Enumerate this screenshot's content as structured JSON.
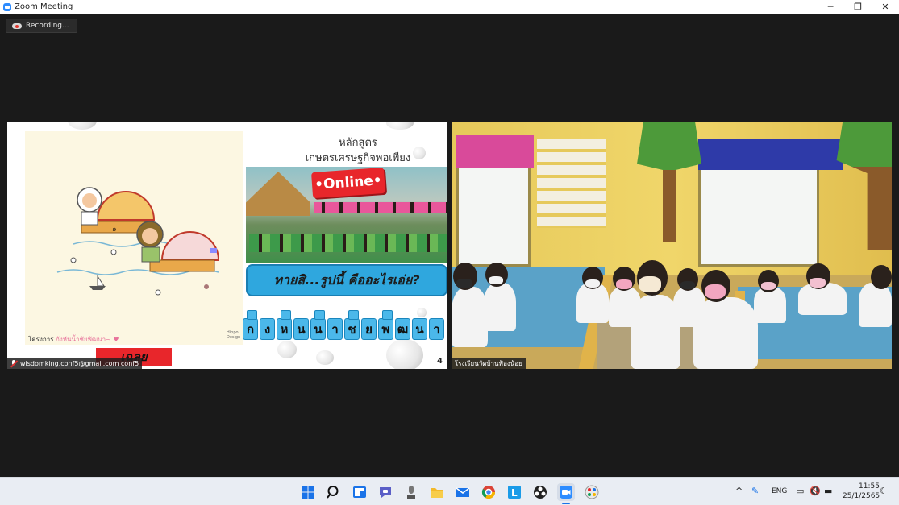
{
  "window": {
    "title": "Zoom Meeting",
    "controls": [
      "─",
      "❐",
      "✕"
    ]
  },
  "recording": {
    "label": "Recording..."
  },
  "tiles": {
    "left": {
      "name": "wisdomking.conf5@gmail.com conf5",
      "slide": {
        "course_line1": "หลักสูตร",
        "course_line2": "เกษตรเศรษฐกิจพอเพียง",
        "online": "•Online•",
        "question": "ทายสิ...รูปนี้ คืออะไรเอ่ย?",
        "letters": [
          "ก",
          "ง",
          "ห",
          "น",
          "น",
          "า",
          "ช",
          "ย",
          "พ",
          "ฒ",
          "น",
          "า"
        ],
        "answer_button": "เฉลย",
        "project_prefix": "โครงการ",
        "project_name": "กังหันน้ำชัยพัฒนา~",
        "publisher": "Hippo Design",
        "page_number": "4"
      }
    },
    "right": {
      "name": "โรงเรียนวัดบ้านฟ้องน้อย"
    }
  },
  "taskbar": {
    "apps": [
      "windows-start",
      "search",
      "widgets",
      "teams-chat",
      "microphone-app",
      "file-explorer",
      "mail",
      "chrome",
      "line",
      "obs",
      "zoom",
      "paint"
    ],
    "tray": {
      "language": "ENG",
      "time": "11:55",
      "date": "25/1/2565"
    }
  },
  "colors": {
    "zoom_blue": "#2d8cff",
    "online_red": "#e8262b",
    "question_blue": "#2fa7de",
    "background": "#1a1a1a"
  }
}
